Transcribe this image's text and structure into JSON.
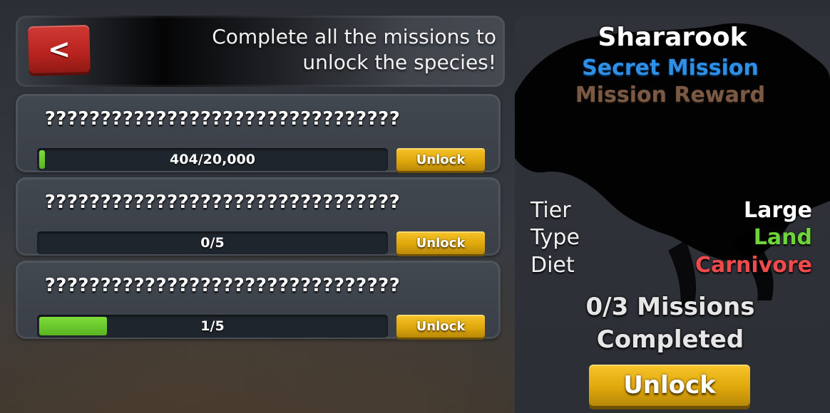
{
  "header": {
    "back_label": "<",
    "instruction_line1": "Complete all the missions to",
    "instruction_line2": "unlock the species!"
  },
  "missions": [
    {
      "title": "????????????????????????????????",
      "progress_text": "404/20,000",
      "progress_fraction": 0.0202,
      "button_label": "Unlock"
    },
    {
      "title": "????????????????????????????????",
      "progress_text": "0/5",
      "progress_fraction": 0.0,
      "button_label": "Unlock"
    },
    {
      "title": "????????????????????????????????",
      "progress_text": "1/5",
      "progress_fraction": 0.2,
      "button_label": "Unlock"
    }
  ],
  "species": {
    "name": "Shararook",
    "secret_label": "Secret Mission",
    "reward_label": "Mission Reward",
    "stats": [
      {
        "label": "Tier",
        "value": "Large",
        "color": "#ffffff"
      },
      {
        "label": "Type",
        "value": "Land",
        "color": "#6fd43a"
      },
      {
        "label": "Diet",
        "value": "Carnivore",
        "color": "#ef4b4b"
      }
    ],
    "completed_line1": "0/3 Missions",
    "completed_line2": "Completed",
    "unlock_label": "Unlock"
  },
  "colors": {
    "accent_gold": "#dfa80c",
    "back_red": "#c12a25",
    "progress_green": "#6cc92c",
    "secret_blue": "#2d8fe6",
    "reward_brown": "#7a5a44"
  },
  "icons": {
    "back": "chevron-left-icon"
  }
}
